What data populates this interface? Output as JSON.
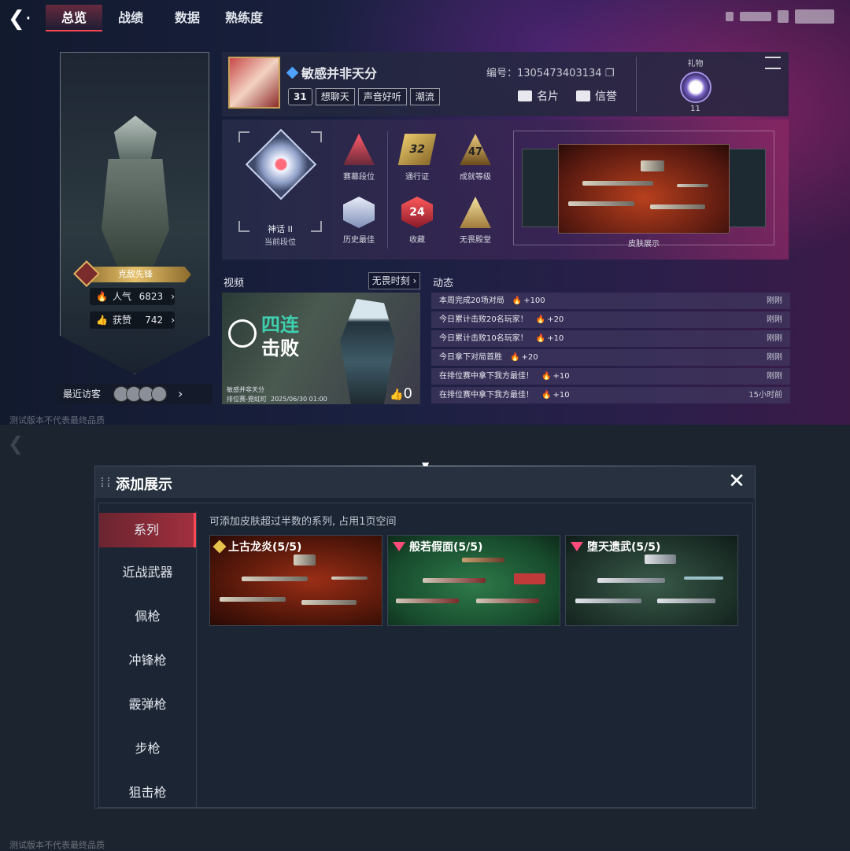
{
  "nav": {
    "tabs": [
      "总览",
      "战绩",
      "数据",
      "熟练度"
    ],
    "active_tab": 0
  },
  "character": {
    "title_badge": "克敌先锋",
    "popularity_label": "人气",
    "popularity_value": "6823",
    "likes_label": "获赞",
    "likes_value": "742",
    "recent_visitors_label": "最近访客"
  },
  "profile": {
    "player_name": "敏感并非天分",
    "level": "31",
    "tags": [
      "想聊天",
      "声音好听",
      "潮流"
    ],
    "id_label": "编号：",
    "id_value": "1305473403134",
    "card_button": "名片",
    "reputation_button": "信誉",
    "gift_label": "礼物",
    "gift_count": "11"
  },
  "ranks": {
    "current_rank_name": "神话 II",
    "current_rank_label": "当前段位",
    "season_rank_label": "赛幕段位",
    "historical_best_label": "历史最佳",
    "battlepass_label": "通行证",
    "battlepass_value": "32",
    "achievement_label": "成就等级",
    "achievement_value": "47",
    "collection_label": "收藏",
    "collection_value": "24",
    "hall_label": "无畏殿堂",
    "skin_display_label": "皮肤展示"
  },
  "video": {
    "section_label": "视频",
    "button_label": "无畏时刻",
    "headline_top": "四连",
    "headline_bottom": "击败",
    "author": "敏感并非天分",
    "mode_map": "排位赛-霓虹町",
    "date": "2025/06/30 01:00",
    "likes": "0"
  },
  "feed": {
    "section_label": "动态",
    "items": [
      {
        "text": "本周完成20场对局",
        "points": "+100",
        "time": "刚刚"
      },
      {
        "text": "今日累计击败20名玩家！",
        "points": "+20",
        "time": "刚刚"
      },
      {
        "text": "今日累计击败10名玩家！",
        "points": "+10",
        "time": "刚刚"
      },
      {
        "text": "今日拿下对局首胜",
        "points": "+20",
        "time": "刚刚"
      },
      {
        "text": "在排位赛中拿下我方最佳！",
        "points": "+10",
        "time": "刚刚"
      },
      {
        "text": "在排位赛中拿下我方最佳！",
        "points": "+10",
        "time": "15小时前"
      }
    ]
  },
  "watermark": "测试版本不代表最终品质",
  "modal": {
    "title": "添加展示",
    "hint": "可添加皮肤超过半数的系列, 占用1页空间",
    "categories": [
      "系列",
      "近战武器",
      "佩枪",
      "冲锋枪",
      "霰弹枪",
      "步枪",
      "狙击枪"
    ],
    "active_category": 0,
    "series": [
      {
        "name": "上古龙炎(5/5)",
        "badge": "gold"
      },
      {
        "name": "般若假面(5/5)",
        "badge": "red"
      },
      {
        "name": "堕天遗武(5/5)",
        "badge": "red"
      }
    ]
  },
  "colors": {
    "accent": "#ff4655",
    "fire": "#ff6a3d",
    "teal_highlight": "#3ed1b0",
    "gold": "#e6c34a"
  }
}
